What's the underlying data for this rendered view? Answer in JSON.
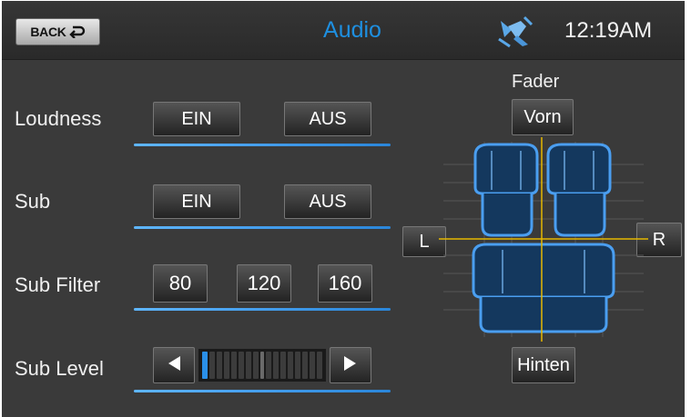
{
  "header": {
    "back_label": "BACK",
    "title": "Audio",
    "time": "12:19AM",
    "icons": {
      "back": "return-arrow-icon",
      "status": "satellite-icon"
    },
    "accent_color": "#1e8fe0"
  },
  "rows": {
    "loudness": {
      "label": "Loudness",
      "on": "EIN",
      "off": "AUS"
    },
    "sub": {
      "label": "Sub",
      "on": "EIN",
      "off": "AUS"
    },
    "sub_filter": {
      "label": "Sub Filter",
      "options": [
        "80",
        "120",
        "160"
      ]
    },
    "sub_level": {
      "label": "Sub Level",
      "level_fraction": 0.05,
      "segments": 17,
      "icons": {
        "decrease": "left-triangle-icon",
        "increase": "right-triangle-icon"
      }
    }
  },
  "fader": {
    "label": "Fader",
    "front": "Vorn",
    "rear": "Hinten",
    "left": "L",
    "right": "R",
    "icon": "car-seats-icon",
    "seat_color": "#4a9ef0",
    "crosshair_color": "#e6b800"
  }
}
